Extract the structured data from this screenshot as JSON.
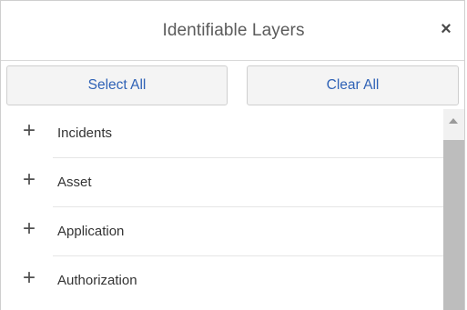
{
  "dialog": {
    "title": "Identifiable Layers",
    "close_icon": "close-icon",
    "close_glyph": "×"
  },
  "actions": {
    "select_all_label": "Select All",
    "clear_all_label": "Clear All",
    "accent_color": "#2f62b6"
  },
  "layers": {
    "expand_glyph": "+",
    "items": [
      {
        "label": "Incidents"
      },
      {
        "label": "Asset"
      },
      {
        "label": "Application"
      },
      {
        "label": "Authorization"
      }
    ]
  }
}
